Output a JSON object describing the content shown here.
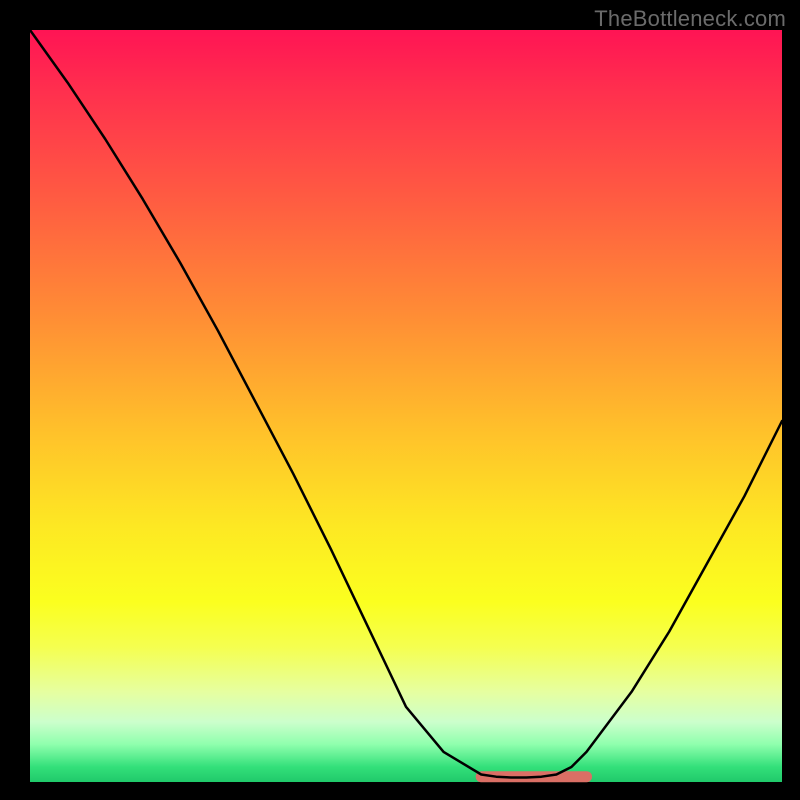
{
  "watermark": "TheBottleneck.com",
  "chart_data": {
    "type": "line",
    "title": "",
    "xlabel": "",
    "ylabel": "",
    "xlim": [
      0,
      100
    ],
    "ylim": [
      0,
      100
    ],
    "grid": false,
    "legend": false,
    "series": [
      {
        "name": "bottleneck-curve",
        "x": [
          0,
          5,
          10,
          15,
          20,
          25,
          30,
          35,
          40,
          45,
          50,
          55,
          60,
          62,
          64,
          66,
          68,
          70,
          72,
          74,
          80,
          85,
          90,
          95,
          100
        ],
        "values": [
          100,
          93,
          85.5,
          77.5,
          69,
          60,
          50.5,
          41,
          31,
          20.5,
          10,
          4,
          1,
          0.7,
          0.6,
          0.6,
          0.7,
          1,
          2,
          4,
          12,
          20,
          29,
          38,
          48
        ]
      }
    ],
    "annotations": [
      {
        "name": "optimal-flat-region",
        "x_start": 60,
        "x_end": 74,
        "y": 0.7
      }
    ],
    "background_gradient": {
      "direction": "vertical",
      "stops": [
        {
          "pos": 0.0,
          "color": "#ff1454"
        },
        {
          "pos": 0.22,
          "color": "#ff5a42"
        },
        {
          "pos": 0.54,
          "color": "#ffc32a"
        },
        {
          "pos": 0.76,
          "color": "#fbff1f"
        },
        {
          "pos": 0.92,
          "color": "#ccffcc"
        },
        {
          "pos": 1.0,
          "color": "#20c96b"
        }
      ]
    }
  }
}
